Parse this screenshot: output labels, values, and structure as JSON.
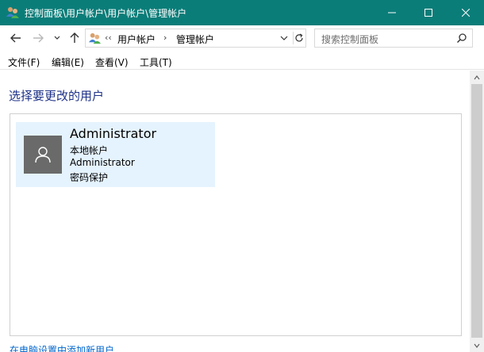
{
  "window": {
    "title": "控制面板\\用户帐户\\用户帐户\\管理帐户",
    "accent": "#0b7d79"
  },
  "nav": {
    "overflow": "‹‹",
    "breadcrumbs": [
      "用户帐户",
      "管理帐户"
    ],
    "search_placeholder": "搜索控制面板"
  },
  "menu": {
    "items": [
      "文件(F)",
      "编辑(E)",
      "查看(V)",
      "工具(T)"
    ]
  },
  "main": {
    "heading": "选择要更改的用户",
    "account": {
      "name": "Administrator",
      "type": "本地帐户",
      "group": "Administrator",
      "status": "密码保护"
    },
    "bottom_link": "在电脑设置中添加新用户"
  },
  "icons": {
    "app": "users-control-panel-icon",
    "back": "back-arrow-icon",
    "forward": "forward-arrow-icon",
    "recent": "chevron-down-icon",
    "up": "up-arrow-icon",
    "refresh": "refresh-icon",
    "search": "search-icon",
    "avatar": "user-silhouette-icon"
  }
}
